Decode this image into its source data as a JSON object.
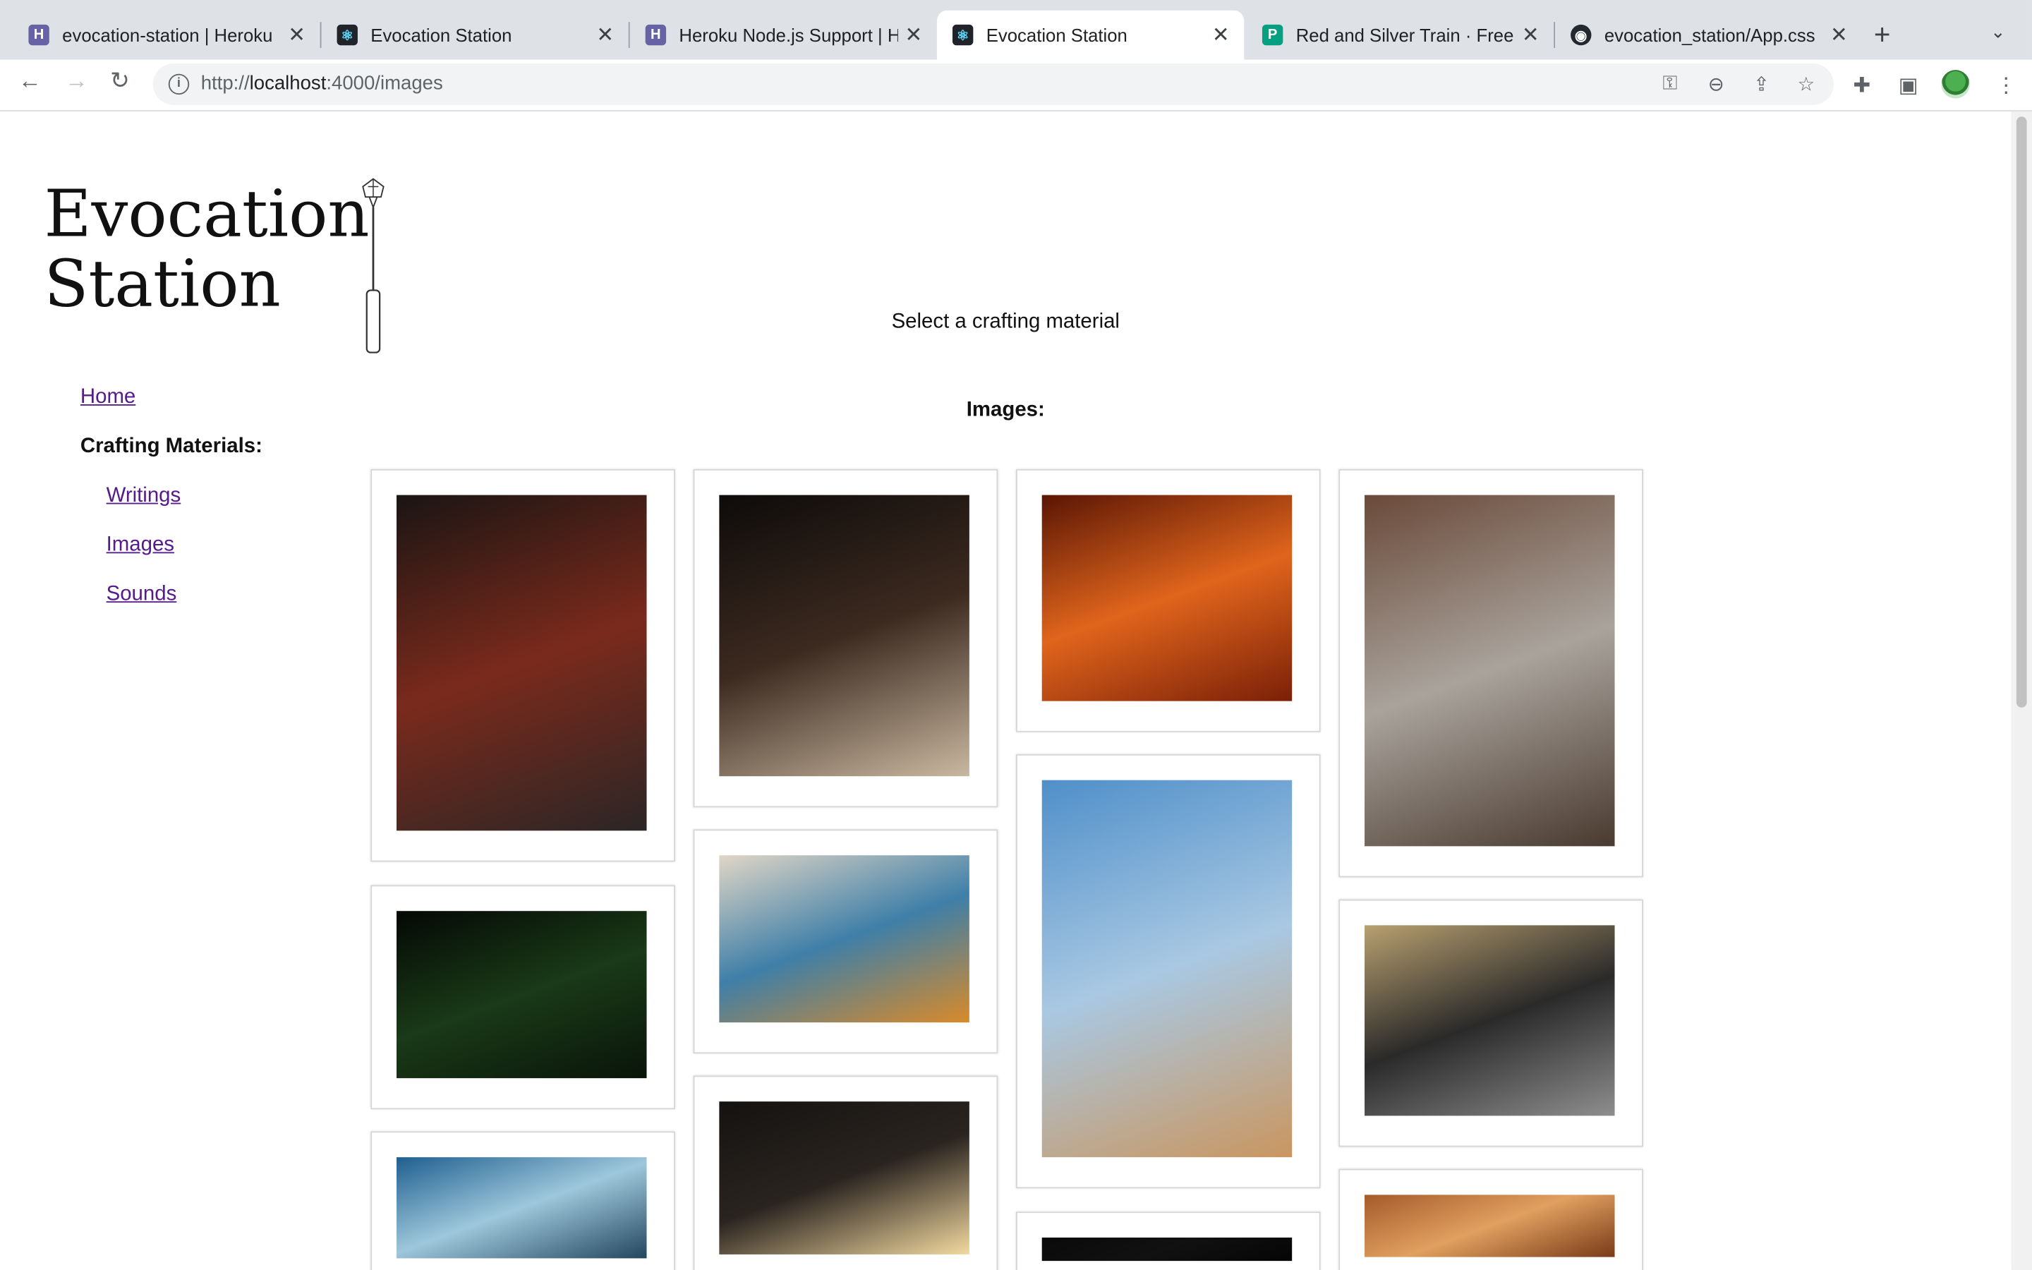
{
  "browser": {
    "tabs": [
      {
        "title": "evocation-station | Heroku",
        "favicon": "heroku-icon",
        "active": false
      },
      {
        "title": "Evocation Station",
        "favicon": "react-icon",
        "active": false
      },
      {
        "title": "Heroku Node.js Support | H",
        "favicon": "heroku-icon",
        "active": false
      },
      {
        "title": "Evocation Station",
        "favicon": "react-icon",
        "active": true
      },
      {
        "title": "Red and Silver Train · Free S",
        "favicon": "pexels-icon",
        "active": false
      },
      {
        "title": "evocation_station/App.css",
        "favicon": "github-icon",
        "active": false
      }
    ],
    "url_prefix": "http://",
    "url_host": "localhost",
    "url_path": ":4000/images"
  },
  "site": {
    "logo_line1": "Evocation",
    "logo_line2": "Station"
  },
  "nav": {
    "home": "Home",
    "crafting_materials": "Crafting Materials:",
    "writings": "Writings",
    "images": "Images",
    "sounds": "Sounds"
  },
  "main": {
    "select_prompt": "Select a crafting material",
    "images_heading": "Images:"
  },
  "gallery": [
    {
      "name": "orchestra-concert-hall-photo",
      "colors": [
        "#1a1514",
        "#7a2a1c",
        "#2b2626"
      ]
    },
    {
      "name": "dessert-glass-table-photo",
      "colors": [
        "#0d0b0a",
        "#3c2a20",
        "#c9b8a0"
      ]
    },
    {
      "name": "bonfire-flames-photo",
      "colors": [
        "#5a1605",
        "#e0651c",
        "#7a2008"
      ]
    },
    {
      "name": "station-clock-railway-photo",
      "colors": [
        "#6a4a3a",
        "#a9a39c",
        "#4a3a30"
      ]
    },
    {
      "name": "firefly-grass-night-photo",
      "colors": [
        "#050805",
        "#1a3a18",
        "#0a140a"
      ]
    },
    {
      "name": "wooden-pergola-lantern-photo",
      "colors": [
        "#e0d6c6",
        "#3f7fa8",
        "#d88a2a"
      ]
    },
    {
      "name": "windmill-wheat-field-photo",
      "colors": [
        "#4f8fc9",
        "#a9c8e2",
        "#c99660"
      ]
    },
    {
      "name": "boombox-graffiti-photo",
      "colors": [
        "#b8a070",
        "#2a2a2a",
        "#8e8e8e"
      ]
    },
    {
      "name": "ocean-waves-rocks-photo",
      "colors": [
        "#1f5f8f",
        "#9ec7db",
        "#22465e"
      ]
    },
    {
      "name": "chicago-theatre-night-photo",
      "colors": [
        "#141210",
        "#2a2420",
        "#f2d9a0"
      ]
    },
    {
      "name": "dark-photo",
      "colors": [
        "#0a0a0a",
        "#111111",
        "#050505"
      ]
    },
    {
      "name": "autumn-trees-photo",
      "colors": [
        "#a55a2a",
        "#e0a060",
        "#7a3a18"
      ]
    }
  ]
}
